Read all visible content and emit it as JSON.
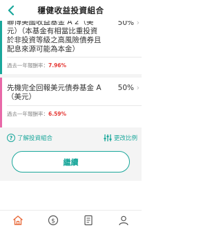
{
  "header": {
    "title": "穩健收益投資組合"
  },
  "funds": [
    {
      "name": "聯博美國收益基金A2（美元）（本基金有相當比重投資於非投資等級之高風險債券且配息來源可能為本金）",
      "display_lines": [
        "聯博美國收益基金 A 2（美",
        "元）（本基金有相當比重投資",
        "於非投資等級之高風險債券且",
        "配息來源可能為本金）"
      ],
      "percent": "50%",
      "return_label": "過去一年報酬率：",
      "return_value": "7.96%",
      "color": "#1aa79b"
    },
    {
      "name": "先機完全回報美元債券基金A（美元）",
      "display_lines": [
        "先機完全回報美元債券基金 A",
        "（美元）"
      ],
      "percent": "50%",
      "return_label": "過去一年報酬率：",
      "return_value": "6.59%",
      "color": "#e868a8"
    }
  ],
  "links": {
    "learn": "了解投資組合",
    "change": "更改比例"
  },
  "continue_label": "繼續",
  "tabbar": [
    "home-icon",
    "dollar-icon",
    "document-icon",
    "user-icon"
  ],
  "colors": {
    "accent": "#1aa79b",
    "accent_active": "#e86a3a",
    "return_red": "#e53935"
  }
}
